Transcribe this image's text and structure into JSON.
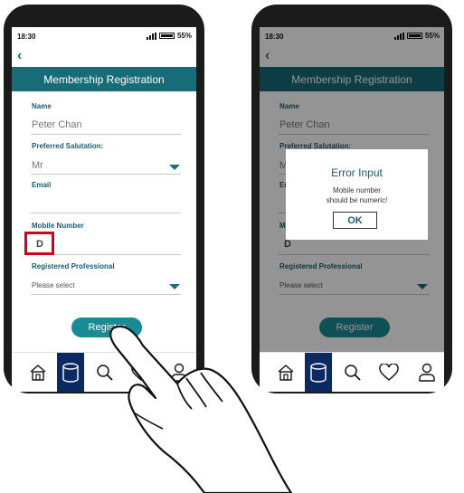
{
  "status_bar": {
    "time": "18:30",
    "battery": "55%"
  },
  "header": {
    "title": "Membership Registration"
  },
  "form": {
    "name_label": "Name",
    "name_value": "Peter Chan",
    "salutation_label": "Preferred Salutation:",
    "salutation_value": "Mr",
    "email_label": "Email",
    "email_value": "",
    "mobile_label": "Mobile Number",
    "mobile_value": "D",
    "professional_label": "Registered Professional",
    "professional_placeholder": "Please select",
    "register_label": "Register"
  },
  "dialog": {
    "title": "Error Input",
    "message_line1": "Mobile number",
    "message_line2": "should be numeric!",
    "ok_label": "OK"
  },
  "tabbar": {
    "items": [
      {
        "icon": "home-icon"
      },
      {
        "icon": "database-icon",
        "active": true
      },
      {
        "icon": "search-icon"
      },
      {
        "icon": "heart-icon"
      },
      {
        "icon": "user-icon"
      }
    ]
  },
  "colors": {
    "header": "#176c78",
    "register_button": "#1a8a95",
    "active_tab": "#0a2a63",
    "error_highlight": "#d0021b"
  }
}
